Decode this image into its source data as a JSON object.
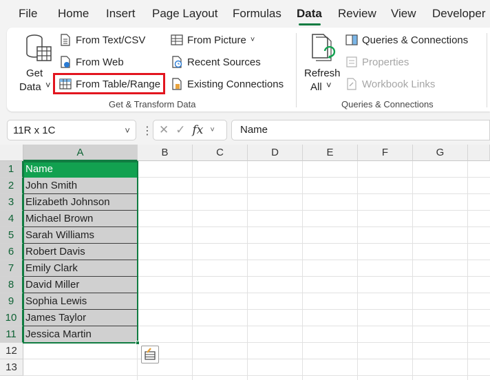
{
  "menu": {
    "tabs": [
      "File",
      "Home",
      "Insert",
      "Page Layout",
      "Formulas",
      "Data",
      "Review",
      "View",
      "Developer"
    ],
    "active": "Data"
  },
  "ribbon": {
    "get_data": {
      "line1": "Get",
      "line2": "Data",
      "chevron": "˅"
    },
    "from_text_csv": "From Text/CSV",
    "from_web": "From Web",
    "from_table_range": "From Table/Range",
    "from_picture": "From Picture",
    "recent_sources": "Recent Sources",
    "existing_connections": "Existing Connections",
    "group1_label": "Get & Transform Data",
    "refresh_all": {
      "line1": "Refresh",
      "line2": "All",
      "chevron": "˅"
    },
    "queries_connections": "Queries & Connections",
    "properties": "Properties",
    "workbook_links": "Workbook Links",
    "group2_label": "Queries & Connections"
  },
  "formula_bar": {
    "name_box": "11R x 1C",
    "fx": "fx",
    "value": "Name"
  },
  "grid": {
    "columns": [
      "A",
      "B",
      "C",
      "D",
      "E",
      "F",
      "G"
    ],
    "rows": [
      "1",
      "2",
      "3",
      "4",
      "5",
      "6",
      "7",
      "8",
      "9",
      "10",
      "11",
      "12",
      "13"
    ],
    "cells_A": [
      "Name",
      "John Smith",
      "Elizabeth Johnson",
      "Michael Brown",
      "Sarah Williams",
      "Robert Davis",
      "Emily Clark",
      "David Miller",
      "Sophia Lewis",
      "James Taylor",
      "Jessica Martin"
    ]
  },
  "colors": {
    "accent": "#107c41",
    "header_fill": "#12a150",
    "highlight": "#e2151f",
    "selection_fill": "#d0d0d0"
  }
}
